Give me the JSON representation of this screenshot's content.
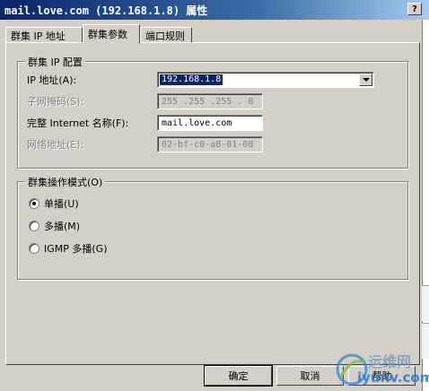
{
  "window": {
    "title": "mail.love.com (192.168.1.8) 属性",
    "help_label": "?"
  },
  "tabs": [
    {
      "label": "群集 IP 地址",
      "active": false
    },
    {
      "label": "群集参数",
      "active": true
    },
    {
      "label": "端口规则",
      "active": false
    }
  ],
  "ip_config": {
    "legend": "群集 IP 配置",
    "ip_label": "IP 地址(A):",
    "ip_value": "192.168.1.8",
    "subnet_label": "子网掩码(S):",
    "subnet_value": "255 .255 .255 . 0",
    "fullname_label": "完整 Internet 名称(F):",
    "fullname_value": "mail.love.com",
    "netaddr_label": "网络地址(E):",
    "netaddr_value": "02-bf-c0-a8-01-08"
  },
  "op_mode": {
    "legend": "群集操作模式(O)",
    "options": [
      {
        "label": "单播(U)",
        "checked": true
      },
      {
        "label": "多播(M)",
        "checked": false
      },
      {
        "label": "IGMP 多播(G)",
        "checked": false
      }
    ]
  },
  "buttons": {
    "ok": "确定",
    "cancel": "取消",
    "help": "帮助"
  },
  "watermark": {
    "line1": "运维网",
    "line2": "iyunv.com"
  }
}
